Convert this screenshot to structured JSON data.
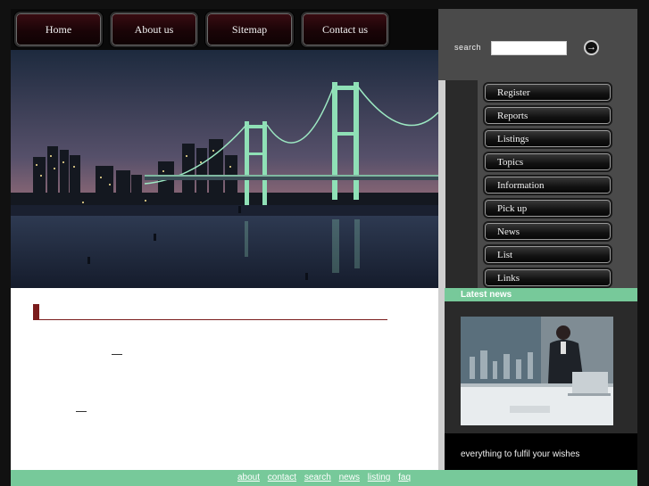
{
  "topnav": [
    "Home",
    "About us",
    "Sitemap",
    "Contact us"
  ],
  "search": {
    "label": "search",
    "value": ""
  },
  "sidemenu": [
    "Register",
    "Reports",
    "Listings",
    "Topics",
    "Information",
    "Pick up",
    "News",
    "List",
    "Links"
  ],
  "news": {
    "heading": "Latest news",
    "caption": "everything to fulfil your wishes"
  },
  "footer": [
    "about",
    "contact",
    "search",
    "news",
    "listing",
    "faq"
  ],
  "colors": {
    "accent": "#77c99a",
    "content_bar": "#7a1c1c",
    "panel": "#4a4a4a"
  }
}
